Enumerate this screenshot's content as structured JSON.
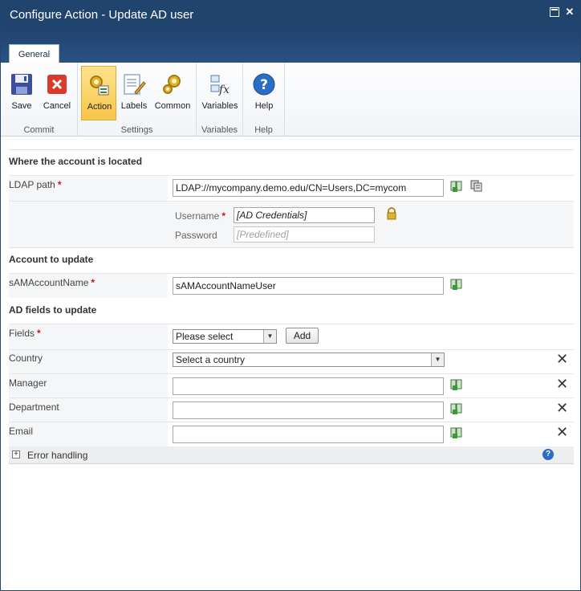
{
  "window": {
    "title": "Configure Action - Update AD user"
  },
  "ribbon": {
    "tab": "General",
    "groups": {
      "commit": "Commit",
      "settings": "Settings",
      "variables": "Variables",
      "help": "Help"
    },
    "buttons": {
      "save": "Save",
      "cancel": "Cancel",
      "action": "Action",
      "labels": "Labels",
      "common": "Common",
      "variables": "Variables",
      "help": "Help"
    }
  },
  "location": {
    "header": "Where the account is located",
    "ldap_label": "LDAP path",
    "ldap_value": "LDAP://mycompany.demo.edu/CN=Users,DC=mycom",
    "username_label": "Username",
    "username_value": "[AD Credentials]",
    "password_label": "Password",
    "password_value": "[Predefined]"
  },
  "account": {
    "header": "Account to update",
    "sam_label": "sAMAccountName",
    "sam_value": "sAMAccountNameUser"
  },
  "fields": {
    "header": "AD fields to update",
    "fields_label": "Fields",
    "fields_select": "Please select",
    "add_button": "Add",
    "country_label": "Country",
    "country_select": "Select a country",
    "manager_label": "Manager",
    "manager_value": "",
    "department_label": "Department",
    "department_value": "",
    "email_label": "Email",
    "email_value": ""
  },
  "error_handling": {
    "label": "Error handling"
  },
  "required_marker": "*",
  "colors": {
    "titlebar": "#21446f",
    "active_button": "#f8c64a",
    "required": "#cc1111"
  }
}
